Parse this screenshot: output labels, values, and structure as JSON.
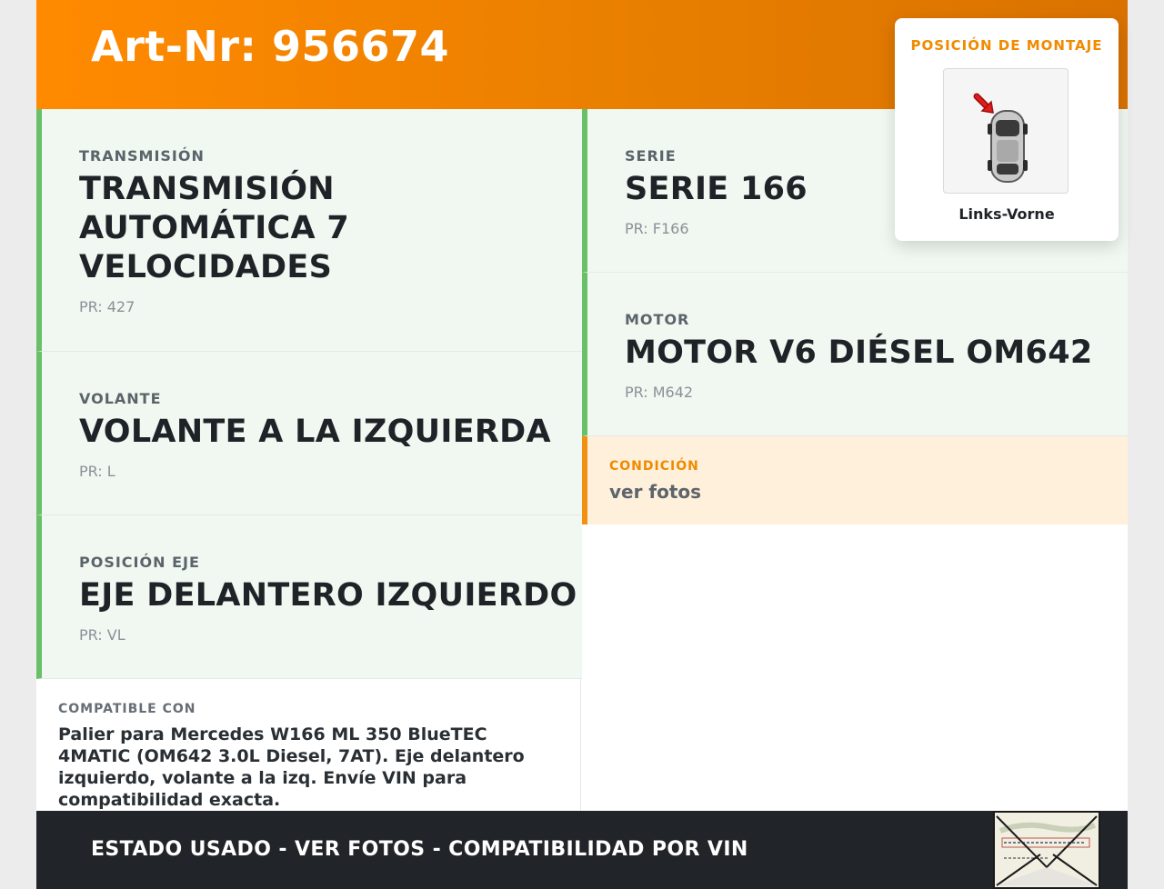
{
  "header": {
    "art_nr": "Art-Nr: 956674"
  },
  "mounting": {
    "title": "POSICIÓN DE MONTAJE",
    "caption": "Links-Vorne"
  },
  "left": [
    {
      "label": "TRANSMISIÓN",
      "value": "TRANSMISIÓN AUTOMÁTICA 7 VELOCIDADES",
      "pr": "PR: 427"
    },
    {
      "label": "VOLANTE",
      "value": "VOLANTE A LA IZQUIERDA",
      "pr": "PR: L"
    },
    {
      "label": "POSICIÓN EJE",
      "value": "EJE DELANTERO IZQUIERDO",
      "pr": "PR: VL"
    }
  ],
  "right": [
    {
      "label": "SERIE",
      "value": "SERIE 166",
      "pr": "PR: F166"
    },
    {
      "label": "MOTOR",
      "value": "MOTOR V6 DIÉSEL OM642",
      "pr": "PR: M642"
    }
  ],
  "condition": {
    "label": "CONDICIÓN",
    "value": "ver fotos"
  },
  "compatible": {
    "label": "COMPATIBLE CON",
    "text": "Palier para Mercedes W166 ML 350 BlueTEC 4MATIC (OM642 3.0L Diesel, 7AT). Eje delantero izquierdo, volante a la izq. Envíe VIN para compatibilidad exacta."
  },
  "footer": {
    "text": "ESTADO USADO - VER FOTOS - COMPATIBILIDAD POR VIN"
  },
  "colors": {
    "accent_orange": "#ff8a00",
    "spec_green": "#6abf69",
    "condition_bg": "#fff0db",
    "footer_bg": "#212529"
  },
  "icons": {
    "mount_image": "car-top-view-icon",
    "mount_arrow": "arrow-front-left-icon",
    "footer_image": "document-photo-thumbnail"
  }
}
